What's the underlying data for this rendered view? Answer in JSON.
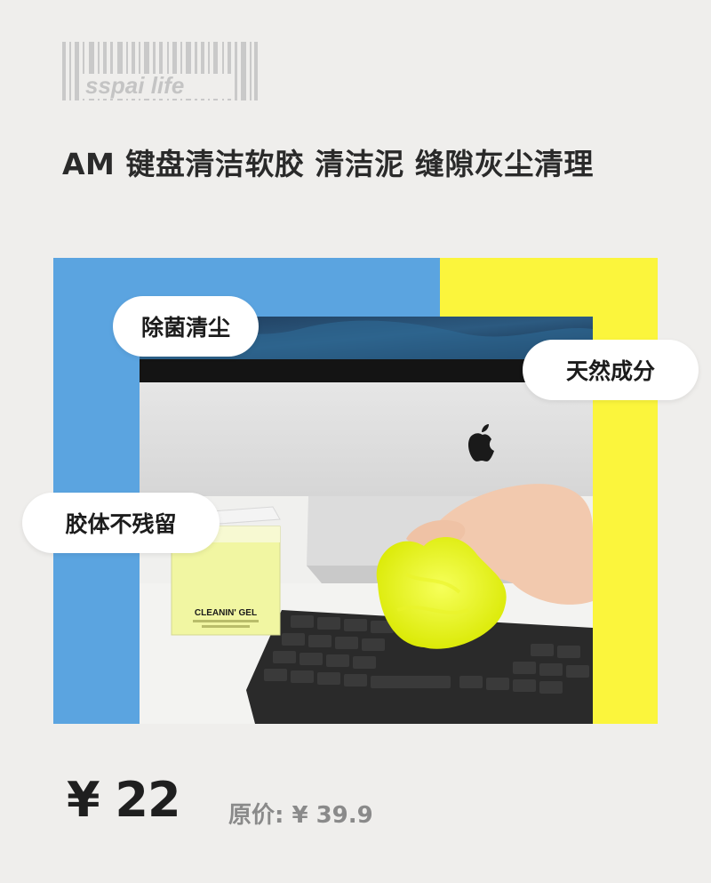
{
  "logo": {
    "text": "sspai life"
  },
  "product": {
    "title": "AM 键盘清洁软胶 清洁泥 缝隙灰尘清理"
  },
  "features": [
    "除菌清尘",
    "天然成分",
    "胶体不残留"
  ],
  "product_image": {
    "package_label": "CLEANIN' GEL"
  },
  "pricing": {
    "price": "¥ 22",
    "original": "原价: ¥ 39.9"
  },
  "colors": {
    "accent_blue": "#5ba4e0",
    "accent_yellow": "#fbf53c",
    "background": "#efeeec"
  }
}
